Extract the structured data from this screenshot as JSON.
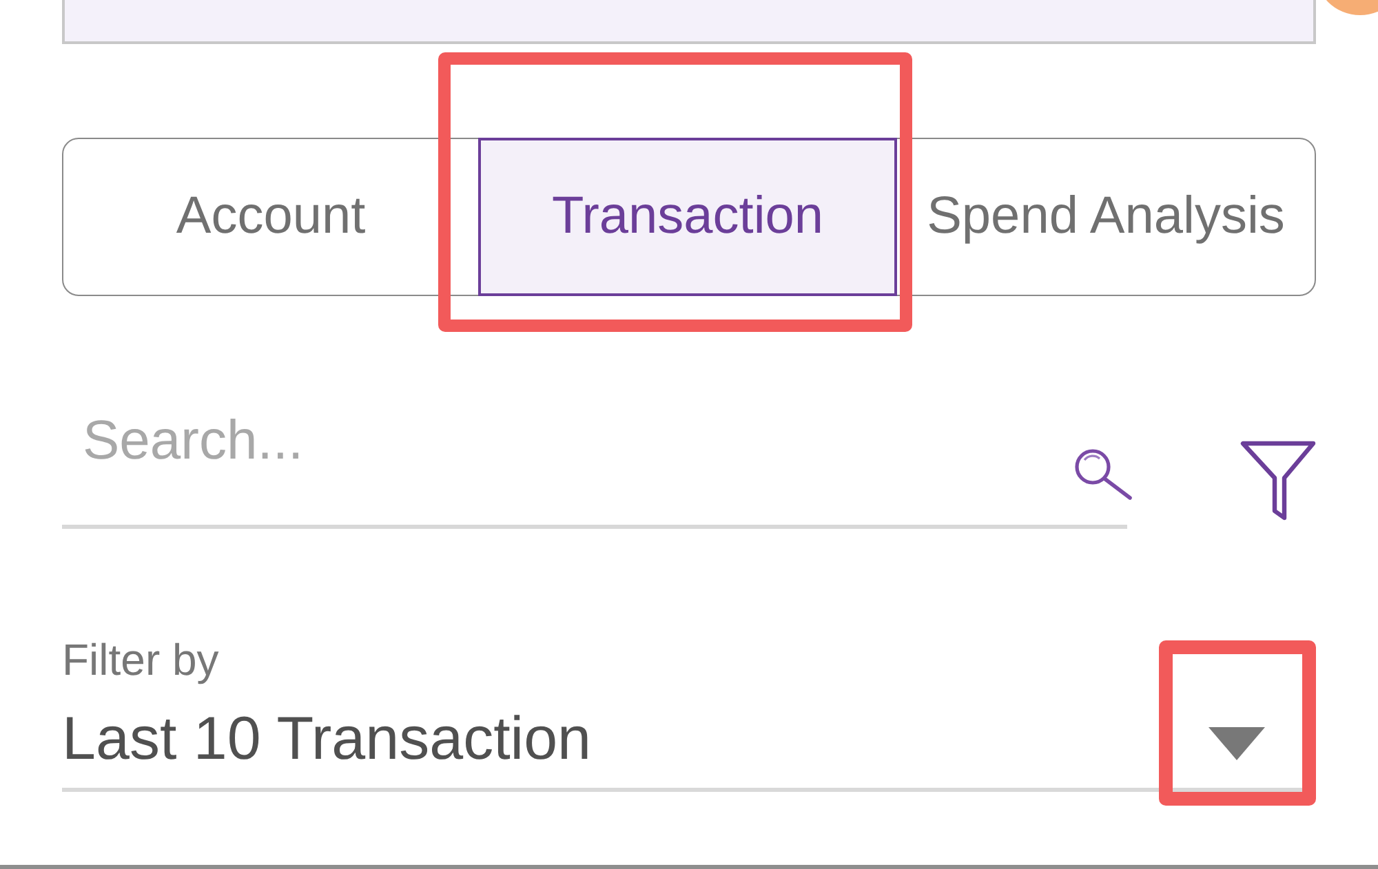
{
  "tabs": [
    {
      "label": "Account",
      "selected": false,
      "highlighted": false
    },
    {
      "label": "Transaction",
      "selected": true,
      "highlighted": true
    },
    {
      "label": "Spend Analysis",
      "selected": false,
      "highlighted": false
    }
  ],
  "search": {
    "placeholder": "Search..."
  },
  "filter": {
    "label": "Filter by",
    "value": "Last 10 Transaction",
    "highlighted": true
  }
}
